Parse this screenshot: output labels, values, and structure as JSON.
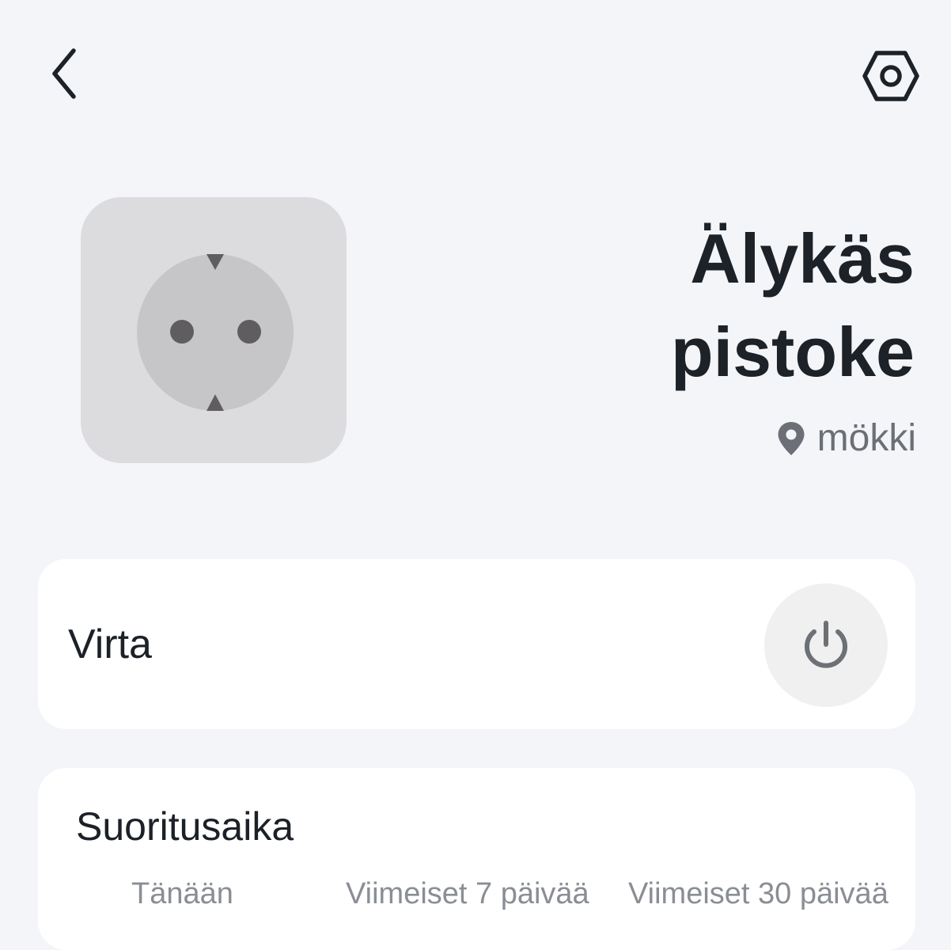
{
  "header": {
    "back_icon": "chevron-left-icon",
    "settings_icon": "hex-gear-icon"
  },
  "device": {
    "image_icon": "power-socket-icon",
    "title": "Älykäs pistoke",
    "location_icon": "location-pin-icon",
    "location": "mökki"
  },
  "power_card": {
    "label": "Virta",
    "button_icon": "power-icon",
    "colors": {
      "icon": "#6d7075",
      "button_bg": "#f0f0f1"
    }
  },
  "runtime_card": {
    "title": "Suoritusaika",
    "tabs": [
      {
        "label": "Tänään"
      },
      {
        "label": "Viimeiset 7 päivää"
      },
      {
        "label": "Viimeiset 30 päivää"
      }
    ]
  },
  "colors": {
    "background": "#f3f5f9",
    "card": "#ffffff",
    "title_text": "#1d2228",
    "secondary_text": "#6c7076",
    "socket_tile": "#dcdcde",
    "socket_face": "#c6c6c8",
    "socket_holes": "#5f5d60"
  }
}
